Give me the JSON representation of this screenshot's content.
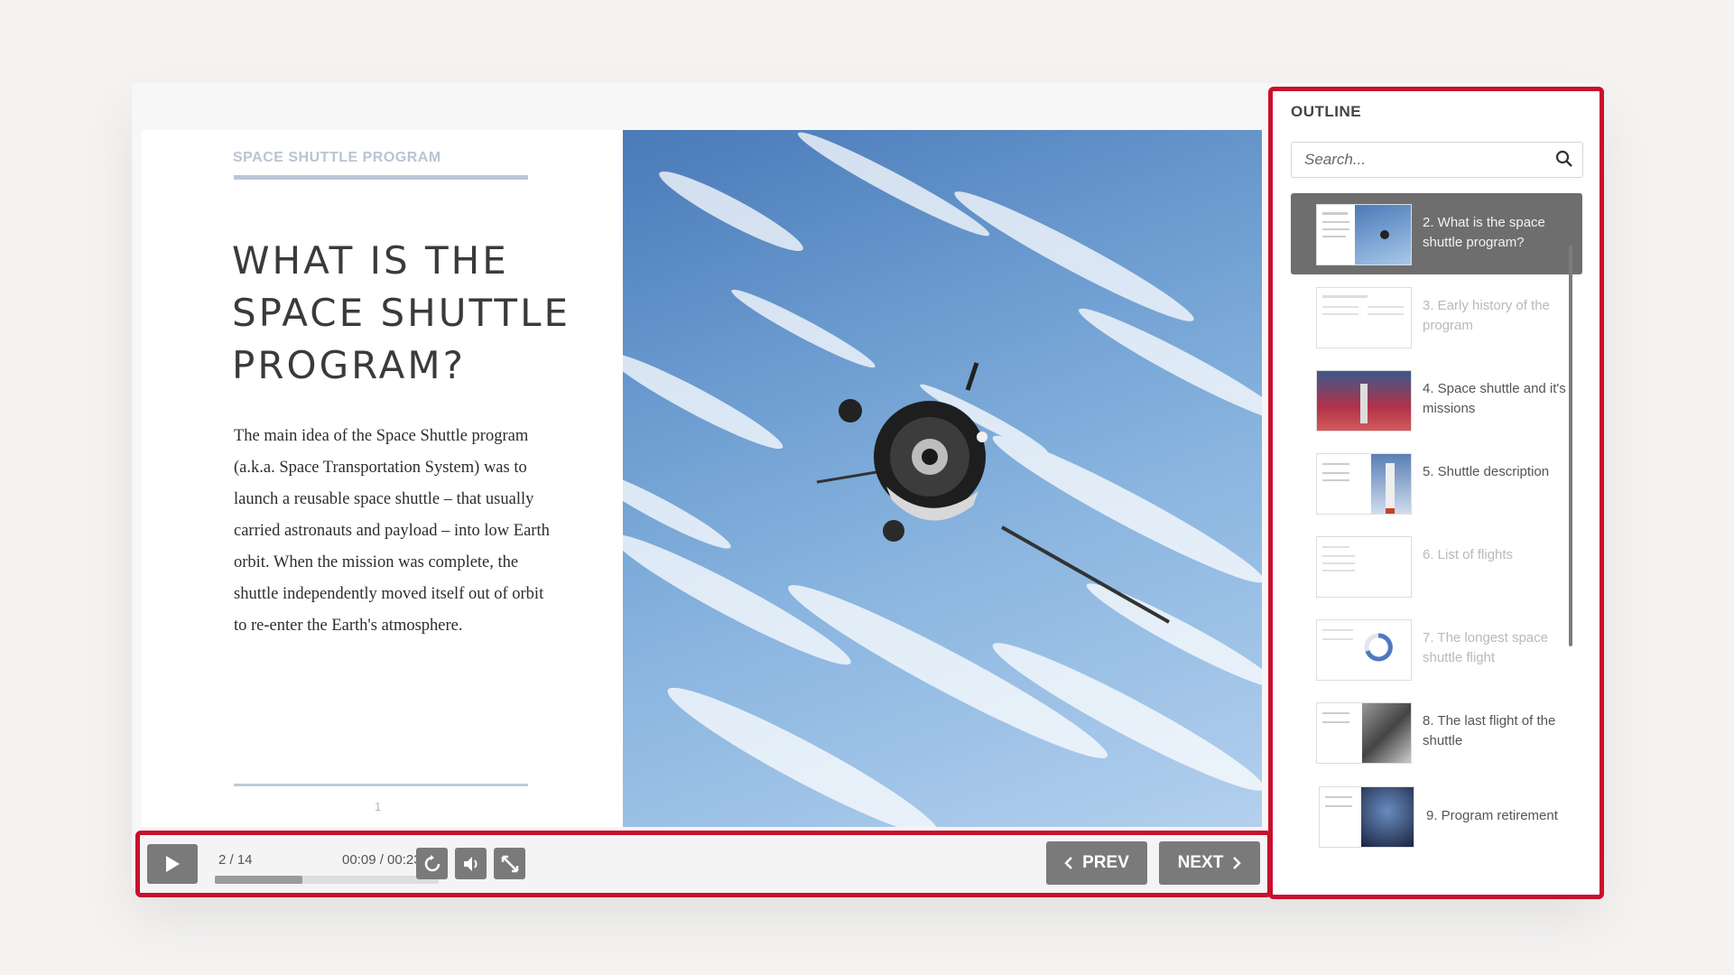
{
  "slide": {
    "subtitle": "SPACE SHUTTLE PROGRAM",
    "title": "WHAT IS THE SPACE SHUTTLE PROGRAM?",
    "body": "The main idea of the Space Shuttle program (a.k.a. Space Transportation System) was to launch a reusable space shuttle – that usually carried astronauts and payload – into low Earth orbit. When the mission was complete, the shuttle independently moved itself out of orbit to re-enter the Earth's atmosphere.",
    "page_number": "1",
    "image": "satellite-in-orbit-photo"
  },
  "controls": {
    "slide_counter": "2 / 14",
    "time": "00:09 / 00:23",
    "progress": 0.39,
    "prev_label": "PREV",
    "next_label": "NEXT",
    "icons": [
      "play-icon",
      "replay-icon",
      "volume-icon",
      "fullscreen-icon"
    ]
  },
  "outline": {
    "title": "OUTLINE",
    "search_placeholder": "Search...",
    "items": [
      {
        "label": "2. What is the space shuttle program?",
        "state": "active"
      },
      {
        "label": "3. Early history of the program",
        "state": "dim"
      },
      {
        "label": "4. Space shuttle and it's missions",
        "state": "normal"
      },
      {
        "label": "5. Shuttle description",
        "state": "normal"
      },
      {
        "label": "6. List of flights",
        "state": "dim"
      },
      {
        "label": "7. The longest space shuttle flight",
        "state": "dim"
      },
      {
        "label": "8. The last flight of the shuttle",
        "state": "normal"
      },
      {
        "label": "9. Program retirement",
        "state": "normal"
      }
    ]
  },
  "colors": {
    "highlight_border": "#c8102e",
    "button_gray": "#7a7a7a",
    "active_item": "#6e6e6e"
  }
}
